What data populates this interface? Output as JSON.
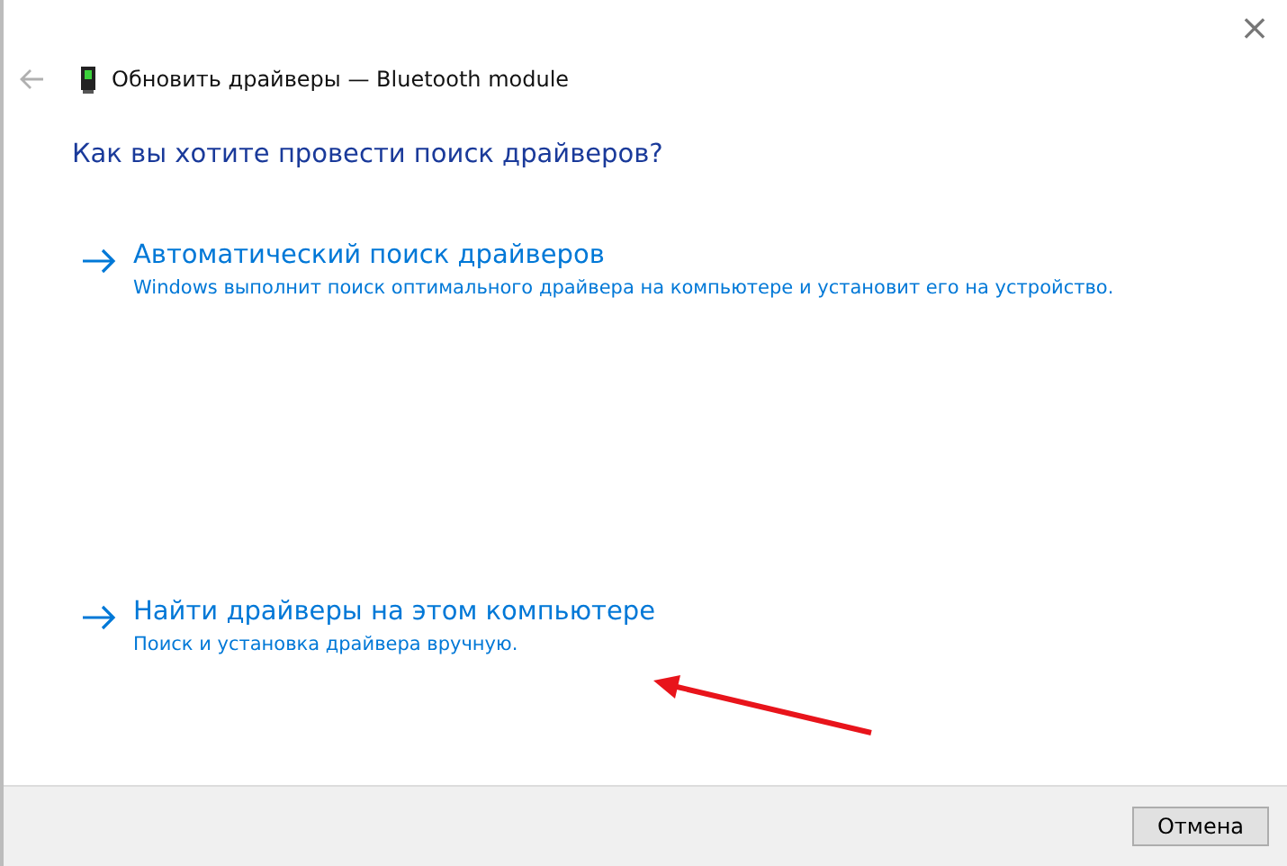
{
  "window": {
    "title": "Обновить драйверы — Bluetooth module",
    "close": "×"
  },
  "heading": "Как вы хотите провести поиск драйверов?",
  "options": [
    {
      "title": "Автоматический поиск драйверов",
      "description": "Windows выполнит поиск оптимального драйвера на компьютере и установит его на устройство."
    },
    {
      "title": "Найти драйверы на этом компьютере",
      "description": "Поиск и установка драйвера вручную."
    }
  ],
  "buttons": [
    "Отмена"
  ]
}
